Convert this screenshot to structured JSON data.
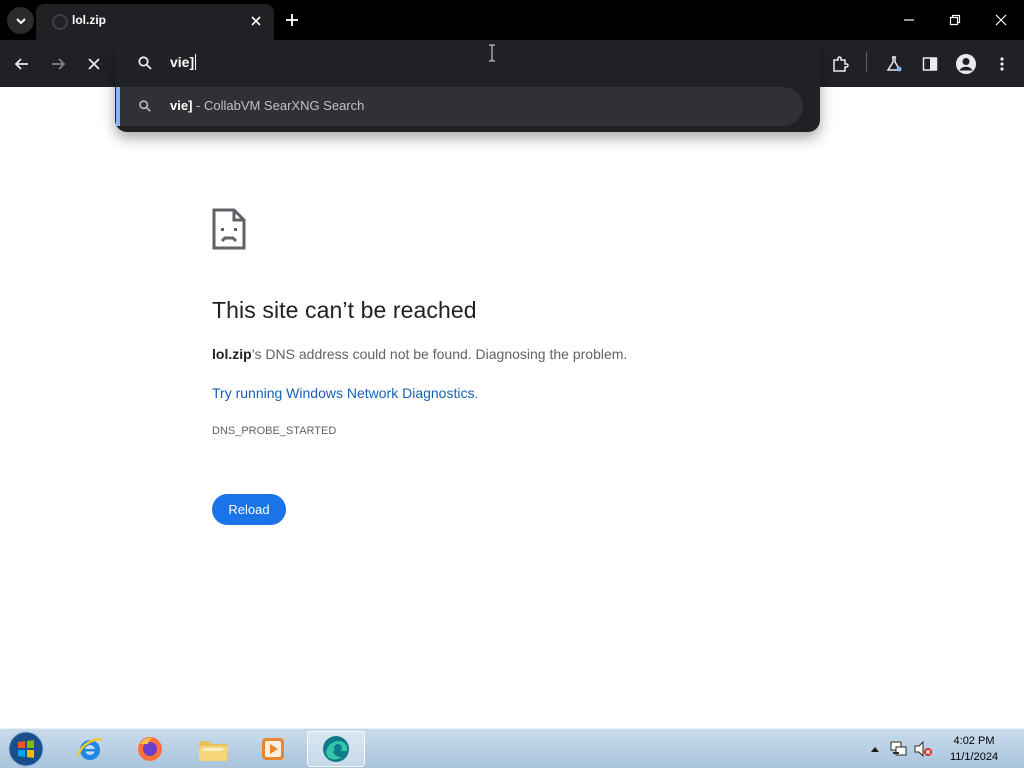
{
  "browser": {
    "tab": {
      "title": "lol.zip"
    },
    "omnibox": {
      "input_value": "vie]",
      "suggestion": {
        "query": "vie]",
        "separator": " - ",
        "provider": "CollabVM SearXNG Search"
      }
    }
  },
  "error_page": {
    "title": "This site can’t be reached",
    "host": "lol.zip",
    "description": "’s DNS address could not be found. Diagnosing the problem.",
    "link_text": "Try running Windows Network Diagnostics",
    "link_suffix": ".",
    "error_code": "DNS_PROBE_STARTED",
    "reload_label": "Reload"
  },
  "taskbar": {
    "apps": [
      "internet-explorer",
      "firefox",
      "file-explorer",
      "media-player",
      "edge"
    ],
    "clock": {
      "time": "4:02 PM",
      "date": "11/1/2024"
    }
  },
  "colors": {
    "accent": "#1a73e8",
    "link": "#1a5fb4",
    "toolbar": "#202124",
    "titlebar": "#000000"
  }
}
